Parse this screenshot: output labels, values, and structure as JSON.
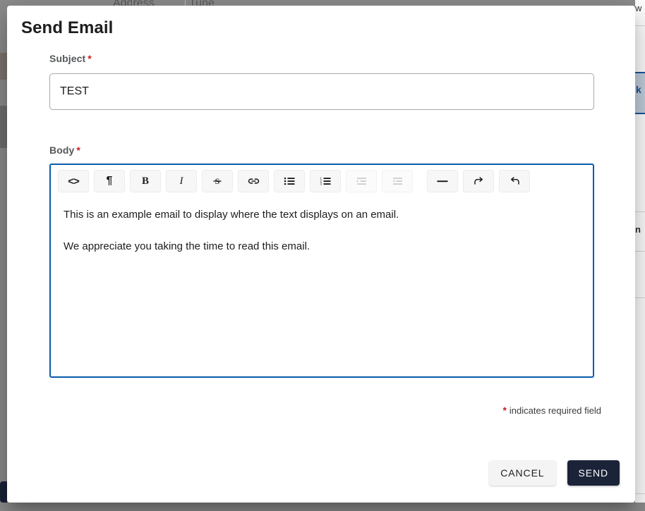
{
  "modal": {
    "title": "Send Email",
    "fields": {
      "subject": {
        "label": "Subject",
        "required_marker": "*",
        "value": "TEST",
        "placeholder": ""
      },
      "body": {
        "label": "Body",
        "required_marker": "*",
        "paragraphs": [
          "This is an example email to display where the text displays on an email.",
          "We appreciate you taking the time to read this email."
        ]
      }
    },
    "toolbar": {
      "buttons": [
        {
          "name": "code-icon",
          "glyph": "<>",
          "label": "Code",
          "disabled": false
        },
        {
          "name": "paragraph-icon",
          "glyph": "¶",
          "label": "Paragraph",
          "disabled": false
        },
        {
          "name": "bold-icon",
          "glyph": "B",
          "label": "Bold",
          "disabled": false
        },
        {
          "name": "italic-icon",
          "glyph": "I",
          "label": "Italic",
          "disabled": false
        },
        {
          "name": "strikethrough-icon",
          "glyph": "S",
          "label": "Strikethrough",
          "disabled": false
        },
        {
          "name": "link-icon",
          "glyph": "🔗",
          "label": "Link",
          "disabled": false
        },
        {
          "name": "bullet-list-icon",
          "glyph": "≡",
          "label": "Bulleted list",
          "disabled": false
        },
        {
          "name": "numbered-list-icon",
          "glyph": "≡",
          "label": "Numbered list",
          "disabled": false
        },
        {
          "name": "indent-icon",
          "glyph": "≡",
          "label": "Increase indent",
          "disabled": true
        },
        {
          "name": "outdent-icon",
          "glyph": "≡",
          "label": "Decrease indent",
          "disabled": true
        },
        {
          "name": "horizontal-rule-icon",
          "glyph": "—",
          "label": "Horizontal rule",
          "disabled": false
        },
        {
          "name": "redo-icon",
          "glyph": "↷",
          "label": "Redo",
          "disabled": false
        },
        {
          "name": "undo-icon",
          "glyph": "↶",
          "label": "Undo",
          "disabled": false
        }
      ]
    },
    "required_hint": {
      "marker": "*",
      "text": "indicates required field"
    },
    "actions": {
      "cancel_label": "CANCEL",
      "send_label": "SEND"
    }
  },
  "colors": {
    "editor_focus_border": "#0b5cab",
    "required_marker": "#cc1f1f",
    "send_button_bg": "#1a2338",
    "cancel_button_bg": "#f4f4f4",
    "scrim": "#8c8c8c",
    "backdrop_selected_row": "#c3cfdd"
  },
  "backdrop": {
    "top_fragments": [
      "Address",
      "Tune"
    ],
    "right_fragments": [
      "w",
      "k",
      "n"
    ]
  }
}
